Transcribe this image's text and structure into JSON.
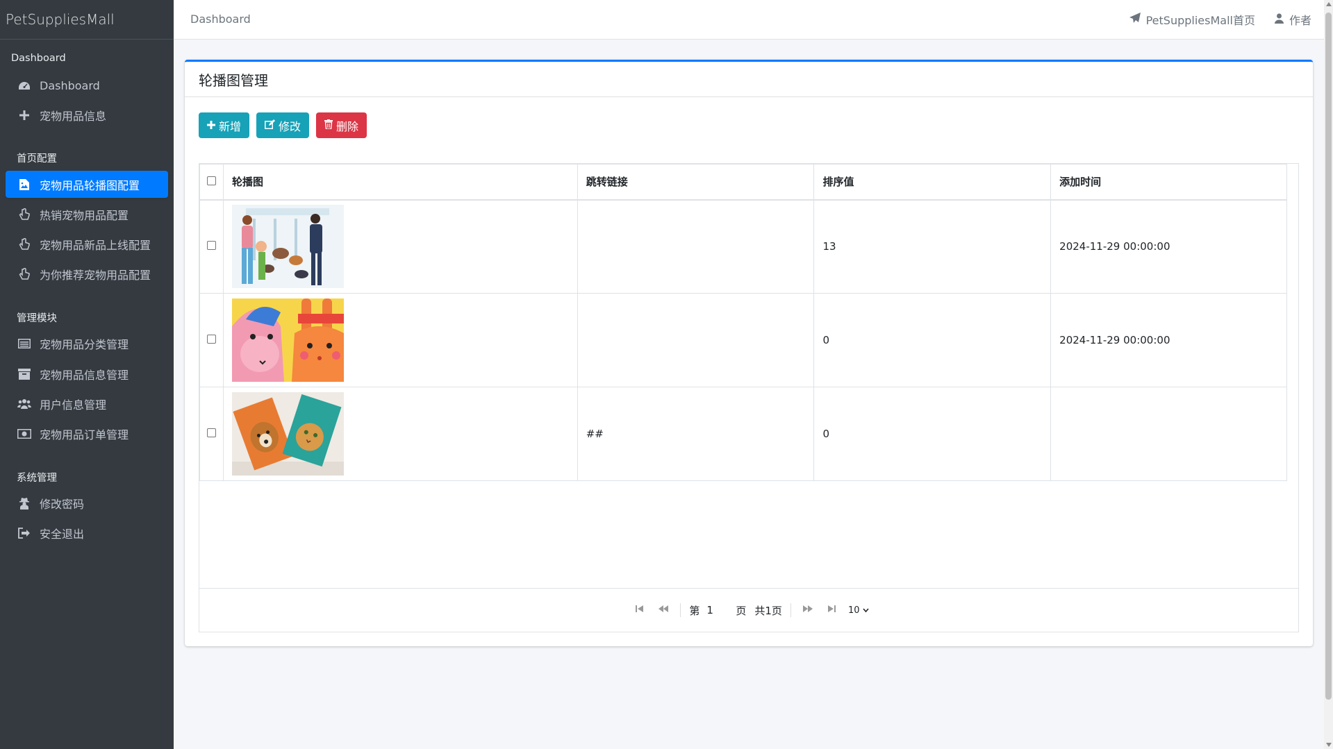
{
  "app": {
    "brand": "PetSuppliesMall"
  },
  "sidebar": {
    "sections": [
      {
        "label": "Dashboard"
      },
      {
        "label": "首页配置"
      },
      {
        "label": "管理模块"
      },
      {
        "label": "系统管理"
      }
    ],
    "items": [
      {
        "label": "Dashboard",
        "icon": "dashboard-icon"
      },
      {
        "label": "宠物用品信息",
        "icon": "plus-icon"
      },
      {
        "label": "宠物用品轮播图配置",
        "icon": "image-icon",
        "active": true
      },
      {
        "label": "热销宠物用品配置",
        "icon": "hand-pointer-icon"
      },
      {
        "label": "宠物用品新品上线配置",
        "icon": "hand-pointer-icon"
      },
      {
        "label": "为你推荐宠物用品配置",
        "icon": "hand-pointer-icon"
      },
      {
        "label": "宠物用品分类管理",
        "icon": "list-icon"
      },
      {
        "label": "宠物用品信息管理",
        "icon": "archive-icon"
      },
      {
        "label": "用户信息管理",
        "icon": "users-icon"
      },
      {
        "label": "宠物用品订单管理",
        "icon": "money-icon"
      },
      {
        "label": "修改密码",
        "icon": "user-secret-icon"
      },
      {
        "label": "安全退出",
        "icon": "sign-out-icon"
      }
    ]
  },
  "topbar": {
    "breadcrumb": "Dashboard",
    "home_link": "PetSuppliesMall首页",
    "author_link": "作者"
  },
  "card": {
    "title": "轮播图管理",
    "buttons": {
      "add": "新增",
      "edit": "修改",
      "delete": "删除"
    }
  },
  "table": {
    "columns": [
      "轮播图",
      "跳转链接",
      "排序值",
      "添加时间"
    ],
    "rows": [
      {
        "image": "carousel-image-1",
        "link": "",
        "order": "13",
        "added": "2024-11-29 00:00:00"
      },
      {
        "image": "carousel-image-2",
        "link": "",
        "order": "0",
        "added": "2024-11-29 00:00:00"
      },
      {
        "image": "carousel-image-3",
        "link": "##",
        "order": "0",
        "added": ""
      }
    ]
  },
  "pager": {
    "page_prefix": "第",
    "page_value": "1",
    "page_suffix": "页",
    "total": "共1页",
    "page_size": "10"
  },
  "colors": {
    "sidebar_bg": "#343a40",
    "active": "#007bff",
    "info": "#17a2b8",
    "danger": "#dc3545"
  }
}
